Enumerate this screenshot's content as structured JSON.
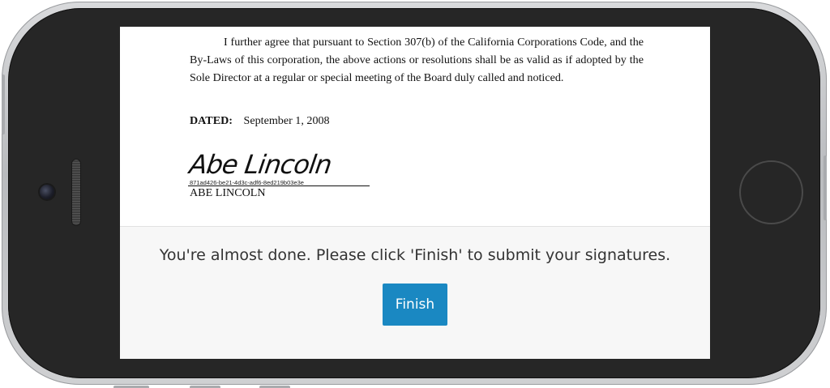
{
  "document": {
    "paragraph": "I further agree that pursuant to Section 307(b) of the California Corporations Code, and the By-Laws of this corporation, the above actions or resolutions shall be as valid as if adopted by the Sole Director at a regular or special meeting of the Board duly called and noticed.",
    "dated_label": "DATED:",
    "dated_value": "September 1, 2008",
    "signature_text": "Abe Lincoln",
    "signature_id": "871ad426-be21-4d3c-adf6-8ed219b03e3e",
    "signer_name": "ABE LINCOLN"
  },
  "finish_panel": {
    "message": "You're almost done. Please click 'Finish' to submit your signatures.",
    "button_label": "Finish"
  },
  "colors": {
    "accent": "#1a88c2",
    "panel_background": "#f7f7f7",
    "phone_body": "#262626"
  },
  "icons": {
    "home_button": "home-button-icon",
    "camera": "front-camera-icon"
  }
}
